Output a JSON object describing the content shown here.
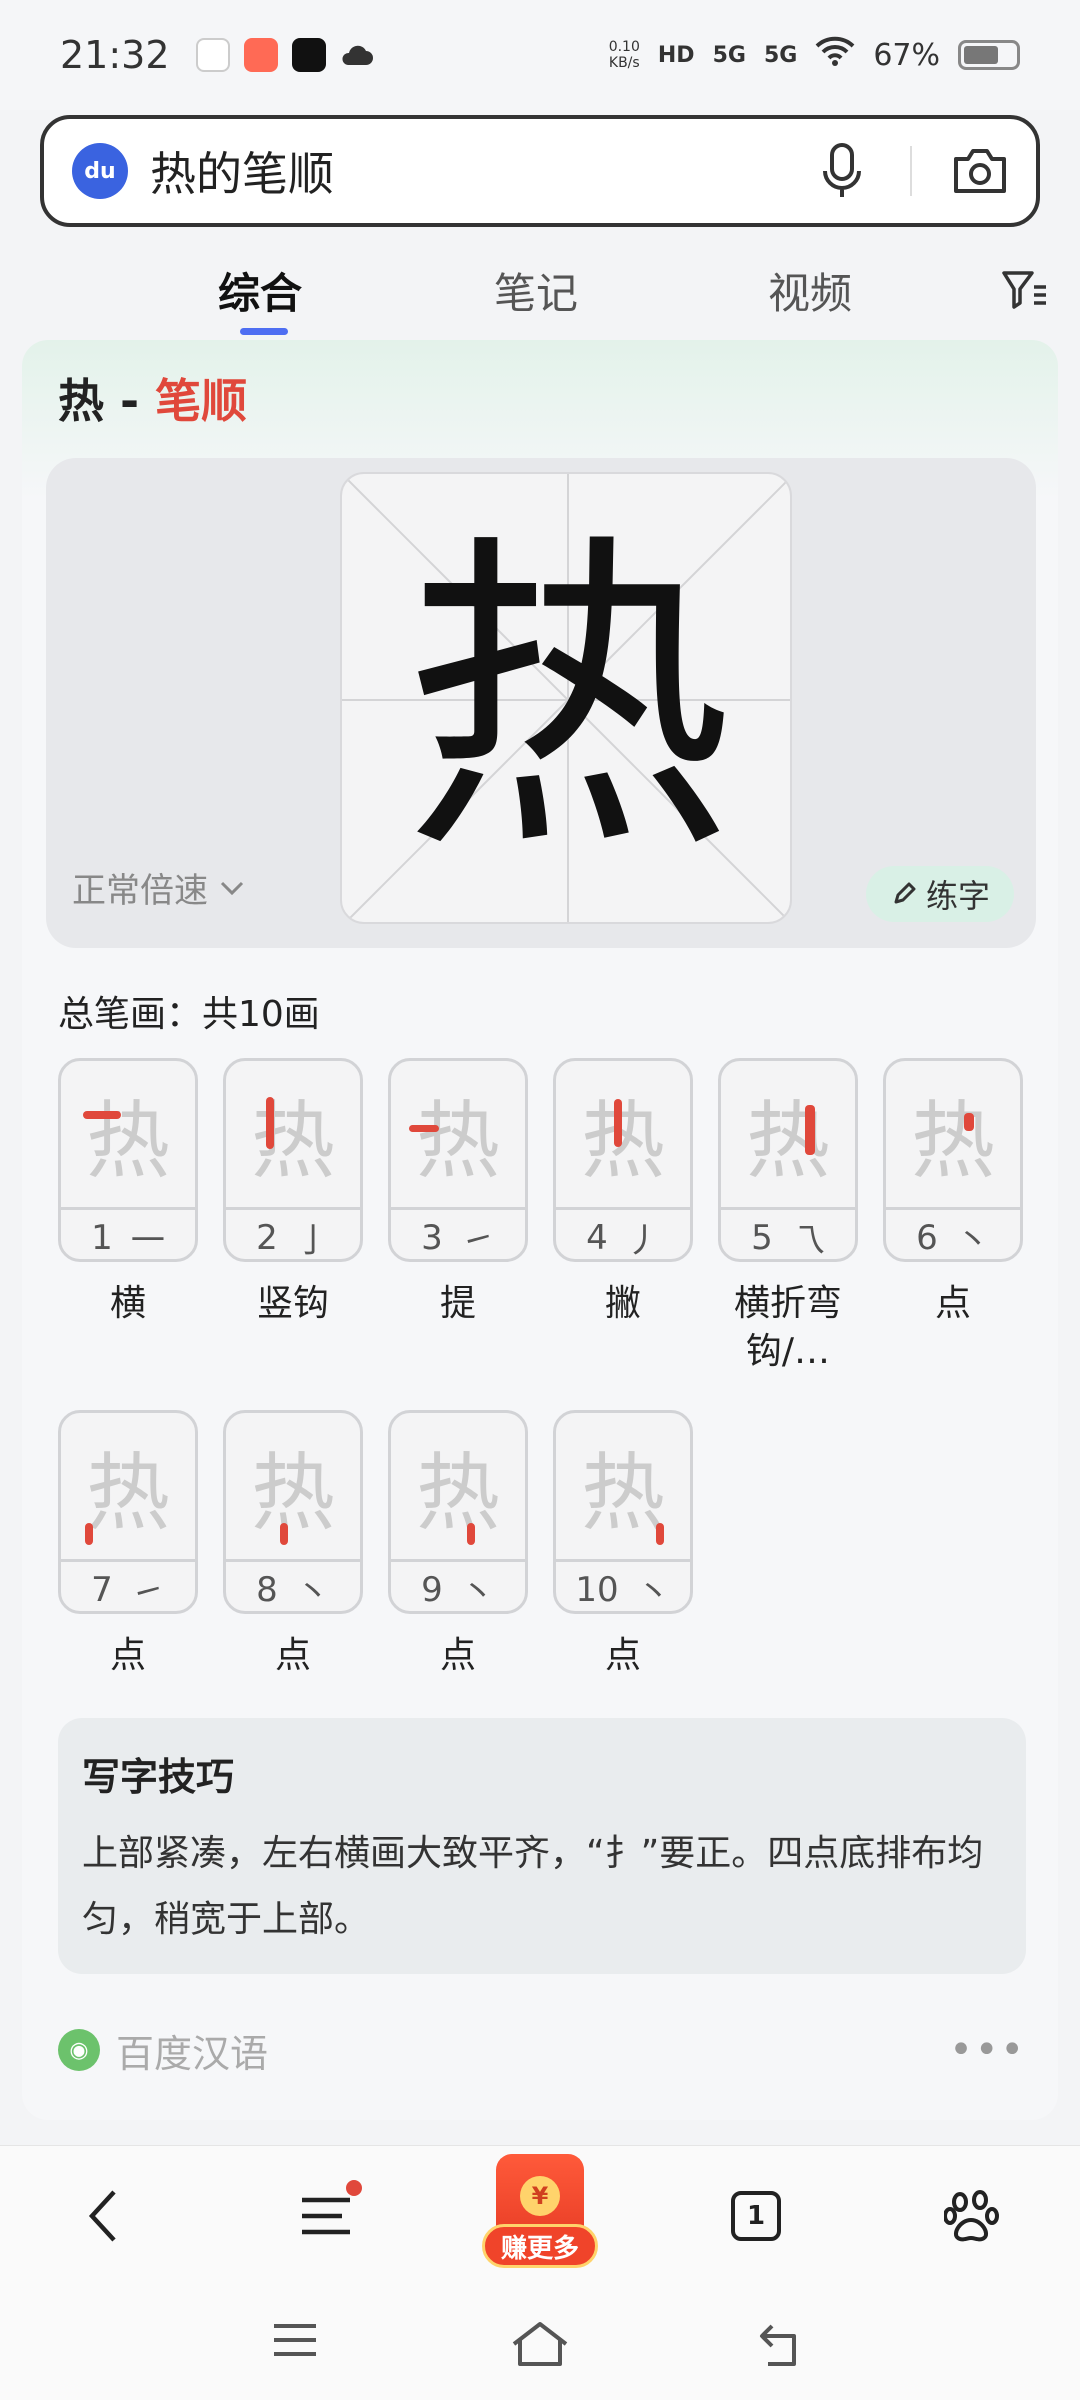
{
  "status_bar": {
    "time": "21:32",
    "net_speed_value": "0.10",
    "net_speed_unit": "KB/s",
    "hd_label": "HD",
    "signal_1": "5G",
    "signal_2": "5G",
    "battery": "67%",
    "battery_level": 0.67
  },
  "search": {
    "logo": "du",
    "query": "热的笔顺"
  },
  "tabs": [
    {
      "label": "综合",
      "active": true
    },
    {
      "label": "笔记",
      "active": false
    },
    {
      "label": "视频",
      "active": false
    }
  ],
  "card": {
    "title_char": "热 - ",
    "title_highlight": "笔顺",
    "main_char": "热",
    "speed_label": "正常倍速",
    "practice_label": "练字",
    "total_strokes": "总笔画：共10画",
    "strokes": [
      {
        "num": "1",
        "glyph": "一",
        "name": "横"
      },
      {
        "num": "2",
        "glyph": "亅",
        "name": "竖钩"
      },
      {
        "num": "3",
        "glyph": "㇀",
        "name": "提"
      },
      {
        "num": "4",
        "glyph": "丿",
        "name": "撇"
      },
      {
        "num": "5",
        "glyph": "乁",
        "name": "横折弯钩/…"
      },
      {
        "num": "6",
        "glyph": "丶",
        "name": "点"
      },
      {
        "num": "7",
        "glyph": "㇀",
        "name": "点"
      },
      {
        "num": "8",
        "glyph": "丶",
        "name": "点"
      },
      {
        "num": "9",
        "glyph": "丶",
        "name": "点"
      },
      {
        "num": "10",
        "glyph": "丶",
        "name": "点"
      }
    ],
    "tips_title": "写字技巧",
    "tips_text": "上部紧凑，左右横画大致平齐，“扌”要正。四点底排布均匀，稍宽于上部。",
    "source_name": "百度汉语",
    "more": "•••"
  },
  "bottom_nav": {
    "earn_label": "赚更多",
    "earn_coin": "¥",
    "tab_count": "1"
  },
  "colors": {
    "accent": "#4e6ef2",
    "highlight_red": "#e0483b",
    "practice_bg": "#d9f0e6"
  }
}
